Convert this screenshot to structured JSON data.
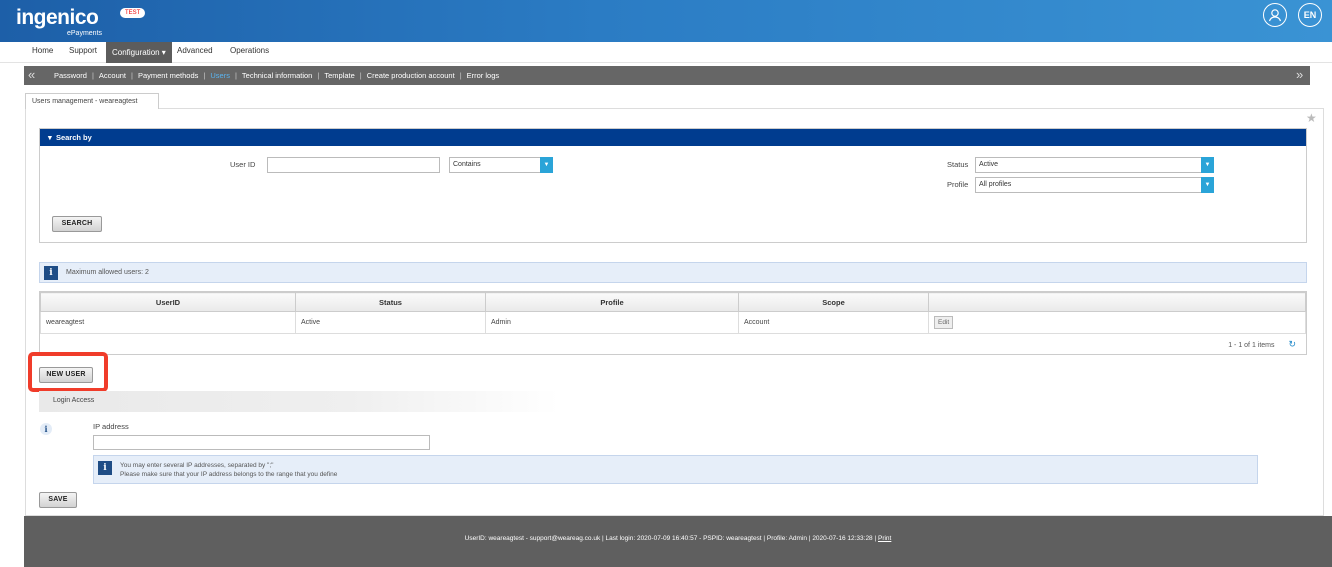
{
  "header": {
    "logo": "ingenico",
    "logo_sub": "ePayments",
    "env_badge": "TEST",
    "lang": "EN",
    "colors": {
      "header_start": "#1d5fa8",
      "header_end": "#3a93d4"
    }
  },
  "main_nav": {
    "items": [
      "Home",
      "Support",
      "Configuration ▾",
      "Advanced",
      "Operations"
    ],
    "active": "Configuration"
  },
  "sub_nav": {
    "left_arrow": "«",
    "right_arrow": "»",
    "links": [
      "Password",
      "Account",
      "Payment methods",
      "Users",
      "Technical information",
      "Template",
      "Create production account",
      "Error logs"
    ],
    "current": "Users"
  },
  "tab": {
    "label": "Users management - weareagtest"
  },
  "search": {
    "title": "Search by",
    "user_id_label": "User ID",
    "user_id_value": "",
    "match_mode": "Contains",
    "status_label": "Status",
    "status_value": "Active",
    "profile_label": "Profile",
    "profile_value": "All profiles",
    "search_button": "SEARCH"
  },
  "info": {
    "max_users": "Maximum allowed users: 2"
  },
  "users_table": {
    "columns": [
      "UserID",
      "Status",
      "Profile",
      "Scope",
      ""
    ],
    "rows": [
      {
        "userid": "weareagtest",
        "status": "Active",
        "profile": "Admin",
        "scope": "Account",
        "action": "Edit"
      }
    ],
    "pager": "1 - 1 of 1 items"
  },
  "new_user_button": "NEW USER",
  "login_access": {
    "title": "Login Access",
    "ip_label": "IP address",
    "ip_value": "",
    "hint_line1": "You may enter several IP addresses, separated by \";\"",
    "hint_line2": "Please make sure that your IP address belongs to the range that you define",
    "save_button": "SAVE"
  },
  "footer": {
    "text": "UserID: weareagtest - support@weareag.co.uk | Last login: 2020-07-09 16:40:57 - PSPID: weareagtest | Profile: Admin | 2020-07-16 12:33:28 | ",
    "print": "Print"
  }
}
